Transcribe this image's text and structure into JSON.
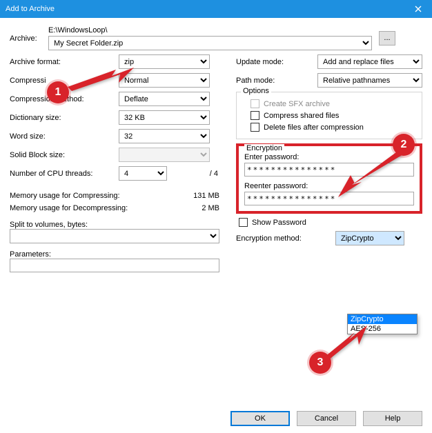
{
  "title": "Add to Archive",
  "archive_label": "Archive:",
  "archive_path": "E:\\WindowsLoop\\",
  "archive_file": "My Secret Folder.zip",
  "browse": "...",
  "left": {
    "format_label": "Archive format:",
    "format_value": "zip",
    "level_label": "Compressi",
    "level_value": "Normal",
    "method_label": "Compression method:",
    "method_value": "Deflate",
    "dict_label": "Dictionary size:",
    "dict_value": "32 KB",
    "word_label": "Word size:",
    "word_value": "32",
    "solid_label": "Solid Block size:",
    "solid_value": "",
    "threads_label": "Number of CPU threads:",
    "threads_value": "4",
    "threads_max": "/ 4",
    "mem_comp_label": "Memory usage for Compressing:",
    "mem_comp_value": "131 MB",
    "mem_decomp_label": "Memory usage for Decompressing:",
    "mem_decomp_value": "2 MB",
    "split_label": "Split to volumes, bytes:",
    "params_label": "Parameters:"
  },
  "right": {
    "update_label": "Update mode:",
    "update_value": "Add and replace files",
    "path_label": "Path mode:",
    "path_value": "Relative pathnames",
    "options_legend": "Options",
    "sfx_label": "Create SFX archive",
    "shared_label": "Compress shared files",
    "delete_label": "Delete files after compression",
    "enc_legend": "Encryption",
    "enter_pw_label": "Enter password:",
    "reenter_pw_label": "Reenter password:",
    "pw_mask": "***************",
    "show_pw_label": "Show Password",
    "enc_method_label": "Encryption method:",
    "enc_method_value": "ZipCrypto",
    "enc_opts": {
      "a": "ZipCrypto",
      "b": "AES-256"
    }
  },
  "buttons": {
    "ok": "OK",
    "cancel": "Cancel",
    "help": "Help"
  },
  "badges": {
    "one": "1",
    "two": "2",
    "three": "3"
  }
}
